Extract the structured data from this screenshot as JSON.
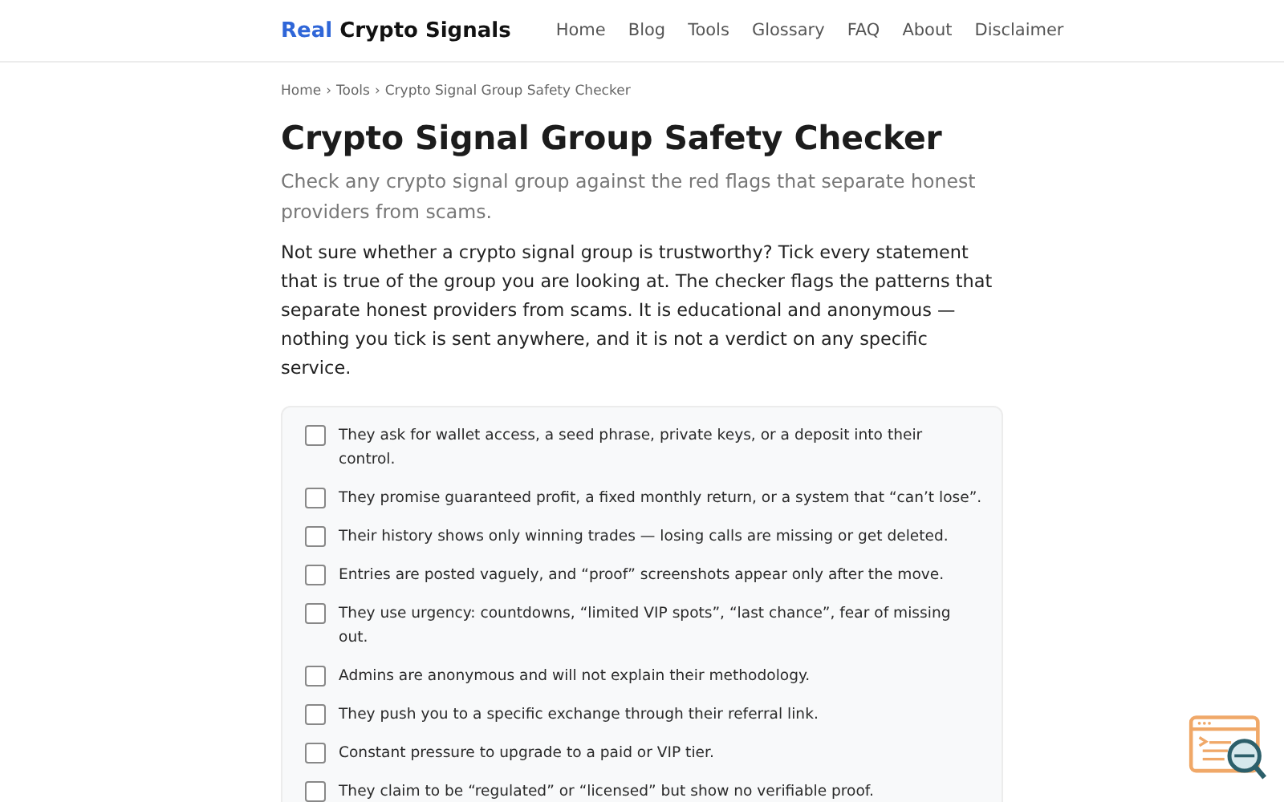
{
  "header": {
    "logo": {
      "accent": "Real",
      "rest": "Crypto Signals"
    },
    "nav": [
      "Home",
      "Blog",
      "Tools",
      "Glossary",
      "FAQ",
      "About",
      "Disclaimer"
    ]
  },
  "breadcrumb": [
    "Home",
    "Tools",
    "Crypto Signal Group Safety Checker"
  ],
  "breadcrumb_separator": "›",
  "title": "Crypto Signal Group Safety Checker",
  "subtitle": "Check any crypto signal group against the red flags that separate honest providers from scams.",
  "intro": "Not sure whether a crypto signal group is trustworthy? Tick every statement that is true of the group you are looking at. The checker flags the patterns that separate honest providers from scams. It is educational and anonymous — nothing you tick is sent anywhere, and it is not a verdict on any specific service.",
  "checklist": [
    {
      "label": "They ask for wallet access, a seed phrase, private keys, or a deposit into their control.",
      "checked": false
    },
    {
      "label": "They promise guaranteed profit, a fixed monthly return, or a system that “can’t lose”.",
      "checked": false
    },
    {
      "label": "Their history shows only winning trades — losing calls are missing or get deleted.",
      "checked": false
    },
    {
      "label": "Entries are posted vaguely, and “proof” screenshots appear only after the move.",
      "checked": false
    },
    {
      "label": "They use urgency: countdowns, “limited VIP spots”, “last chance”, fear of missing out.",
      "checked": false
    },
    {
      "label": "Admins are anonymous and will not explain their methodology.",
      "checked": false
    },
    {
      "label": "They push you to a specific exchange through their referral link.",
      "checked": false
    },
    {
      "label": "Constant pressure to upgrade to a paid or VIP tier.",
      "checked": false
    },
    {
      "label": "They claim to be “regulated” or “licensed” but show no verifiable proof.",
      "checked": false
    }
  ]
}
